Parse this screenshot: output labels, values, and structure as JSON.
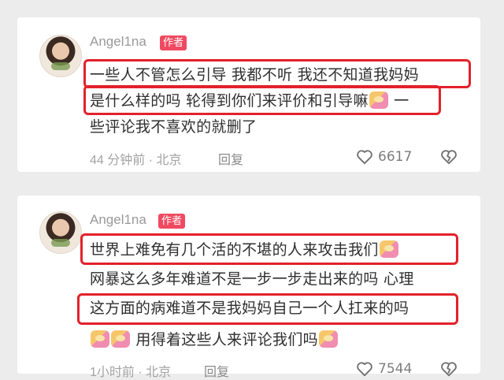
{
  "comments": [
    {
      "author": "Angel1na",
      "badge": "作者",
      "lines": [
        "一些人不管怎么引导 我都不听 我还不知道我妈妈",
        "是什么样的吗 轮得到你们来评价和引导嘛",
        " 一",
        "些评论我不喜欢的就删了"
      ],
      "time_location": "44 分钟前 · 北京",
      "reply_label": "回复",
      "like_count": "6617"
    },
    {
      "author": "Angel1na",
      "badge": "作者",
      "lines": [
        "世界上难免有几个活的不堪的人来攻击我们",
        "网暴这么多年难道不是一步一步走出来的吗 心理",
        "这方面的病难道不是我妈妈自己一个人扛来的吗",
        "用得着这些人来评论我们吗"
      ],
      "time_location": "1小时前 · 北京",
      "reply_label": "回复",
      "like_count": "7544"
    }
  ],
  "icons": {
    "like": "heart-outline-icon",
    "dislike": "broken-heart-icon",
    "emoji": "hugging-face-emoji"
  },
  "colors": {
    "highlight": "#e2212b",
    "badge": "#f04a61"
  }
}
